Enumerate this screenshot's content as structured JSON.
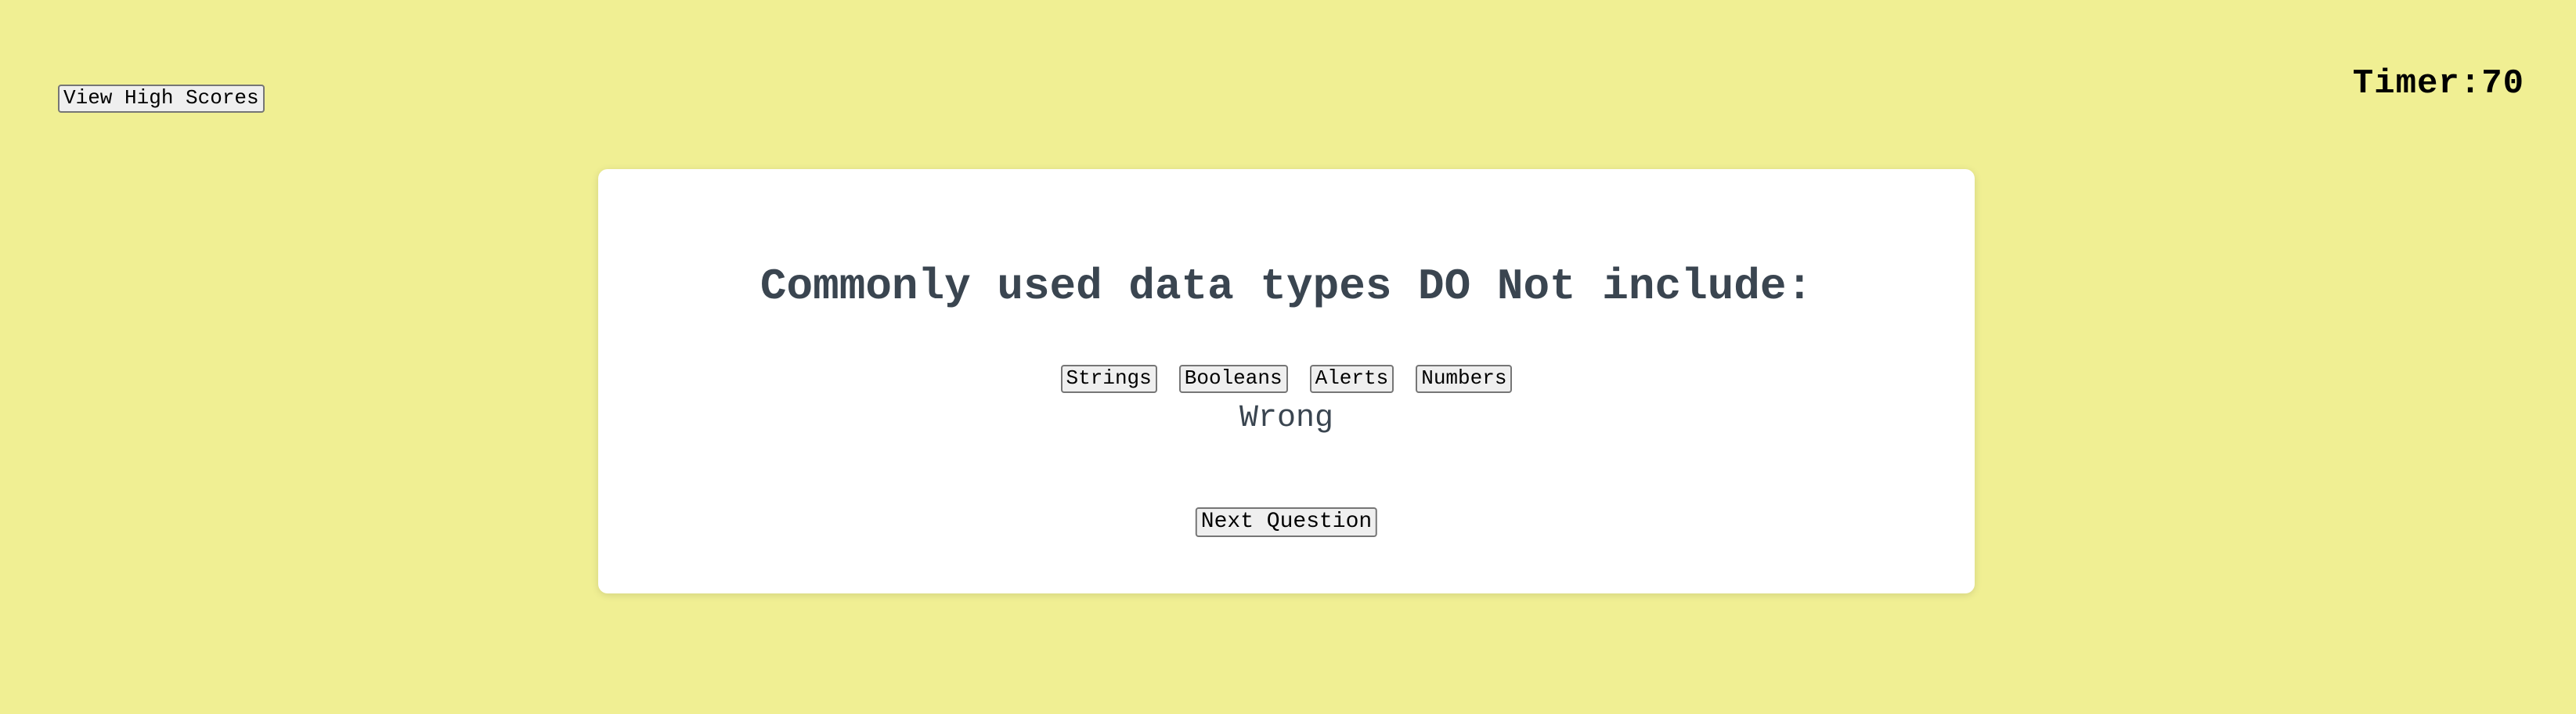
{
  "header": {
    "high_scores_label": "View High Scores",
    "timer_text": "Timer:70"
  },
  "quiz": {
    "question": "Commonly used data types DO Not include:",
    "choices": [
      {
        "label": "Strings"
      },
      {
        "label": "Booleans"
      },
      {
        "label": "Alerts"
      },
      {
        "label": "Numbers"
      }
    ],
    "result": "Wrong",
    "next_label": "Next Question"
  },
  "colors": {
    "background": "#f0ef93",
    "card": "#ffffff",
    "question_text": "#3a4550"
  }
}
